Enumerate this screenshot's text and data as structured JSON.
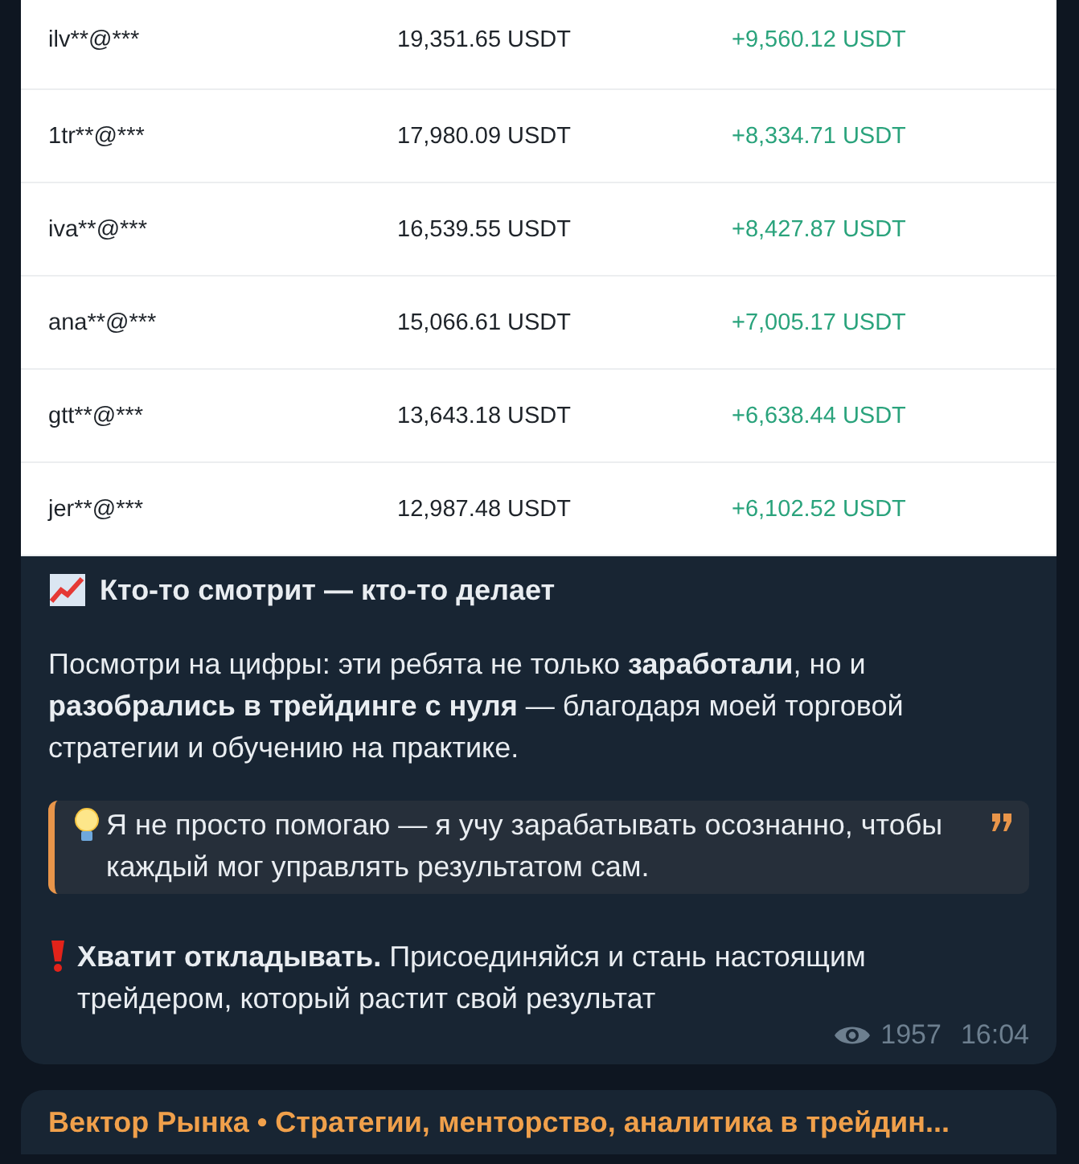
{
  "table_image": {
    "rows": [
      {
        "user": "ilv**@***",
        "balance": "19,351.65 USDT",
        "profit": "+9,560.12 USDT"
      },
      {
        "user": "1tr**@***",
        "balance": "17,980.09 USDT",
        "profit": "+8,334.71 USDT"
      },
      {
        "user": "iva**@***",
        "balance": "16,539.55 USDT",
        "profit": "+8,427.87 USDT"
      },
      {
        "user": "ana**@***",
        "balance": "15,066.61 USDT",
        "profit": "+7,005.17 USDT"
      },
      {
        "user": "gtt**@***",
        "balance": "13,643.18 USDT",
        "profit": "+6,638.44 USDT"
      },
      {
        "user": "jer**@***",
        "balance": "12,987.48 USDT",
        "profit": "+6,102.52 USDT"
      }
    ]
  },
  "message": {
    "title": "Кто-то смотрит — кто-то делает",
    "paragraph": "Посмотри на цифры: эти ребята не только **заработали**, но и **разобрались в трейдинге с нуля** — благодаря моей торговой стратегии и обучению на практике.",
    "quote": "Я не просто помогаю — я учу зарабатывать осознанно, чтобы каждый мог управлять результатом сам.",
    "call_to_action": "**Хватит откладывать.** Присоединяйся и стань настоящим трейдером, который растит свой результат",
    "views": "1957",
    "time": "16:04"
  },
  "next_message": {
    "sender": "Вектор Рынка • Стратегии, менторство, аналитика в трейдин..."
  }
}
